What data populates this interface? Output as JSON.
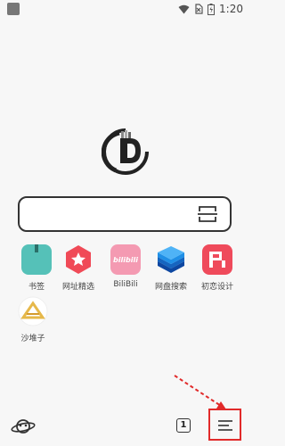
{
  "status_bar": {
    "time": "1:20"
  },
  "search": {
    "value": "",
    "placeholder": ""
  },
  "shortcuts": [
    {
      "label": "书签",
      "icon": "bookmark-icon",
      "color": "#55c1b8"
    },
    {
      "label": "网址精选",
      "icon": "star-hexagon-icon",
      "color": "#f04a57"
    },
    {
      "label": "BiliBili",
      "icon": "bilibili-icon",
      "color": "#f49ab2",
      "tile_text": "bilibili"
    },
    {
      "label": "网盘搜索",
      "icon": "layers-icon",
      "color": "#1f8fe6"
    },
    {
      "label": "初恋设计",
      "icon": "p-logo-icon",
      "color": "#ef4a5b"
    },
    {
      "label": "沙堆子",
      "icon": "sand-logo-icon",
      "color": "#e6b84a"
    }
  ],
  "bottom_bar": {
    "tab_count": "1"
  },
  "colors": {
    "highlight_red": "#e12a2a",
    "background": "#f7f7f7"
  }
}
